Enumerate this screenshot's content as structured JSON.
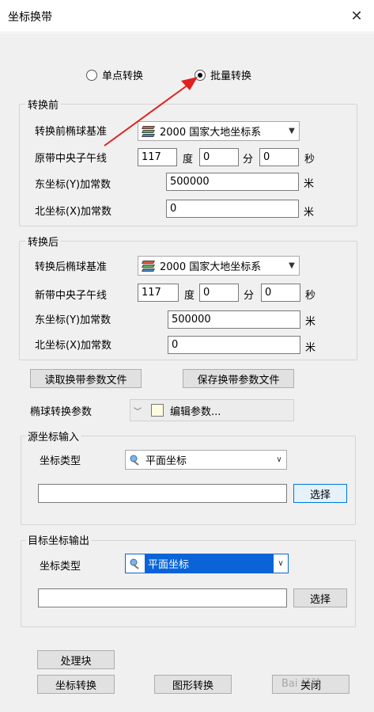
{
  "window": {
    "title": "坐标换带",
    "close_glyph": "✕"
  },
  "mode": {
    "single_label": "单点转换",
    "batch_label": "批量转换",
    "selected": "batch"
  },
  "before": {
    "legend": "转换前",
    "datum_label": "转换前椭球基准",
    "datum_value": "2000  国家大地坐标系",
    "meridian_label": "原带中央子午线",
    "deg_value": "117",
    "deg_unit": "度",
    "min_value": "0",
    "min_unit": "分",
    "sec_value": "0",
    "sec_unit": "秒",
    "east_label": "东坐标(Y)加常数",
    "east_value": "500000",
    "east_unit": "米",
    "north_label": "北坐标(X)加常数",
    "north_value": "0",
    "north_unit": "米"
  },
  "after": {
    "legend": "转换后",
    "datum_label": "转换后椭球基准",
    "datum_value": "2000  国家大地坐标系",
    "meridian_label": "新带中央子午线",
    "deg_value": "117",
    "deg_unit": "度",
    "min_value": "0",
    "min_unit": "分",
    "sec_value": "0",
    "sec_unit": "秒",
    "east_label": "东坐标(Y)加常数",
    "east_value": "500000",
    "east_unit": "米",
    "north_label": "北坐标(X)加常数",
    "north_value": "0",
    "north_unit": "米"
  },
  "param_buttons": {
    "read_label": "读取换带参数文件",
    "save_label": "保存换带参数文件"
  },
  "ellipsoid": {
    "label": "椭球转换参数",
    "edit_label": "编辑参数..."
  },
  "source": {
    "legend": "源坐标输入",
    "type_label": "坐标类型",
    "type_value": "平面坐标",
    "path_value": "",
    "select_label": "选择"
  },
  "target": {
    "legend": "目标坐标输出",
    "type_label": "坐标类型",
    "type_value": "平面坐标",
    "path_value": "",
    "select_label": "选择"
  },
  "actions": {
    "process_label": "处理块",
    "coord_convert_label": "坐标转换",
    "graphic_convert_label": "图形转换",
    "close_label": "关闭"
  },
  "watermark": "Bai 经验",
  "colors": {
    "annotation_arrow": "#e02020",
    "selection": "#0a64d8"
  }
}
